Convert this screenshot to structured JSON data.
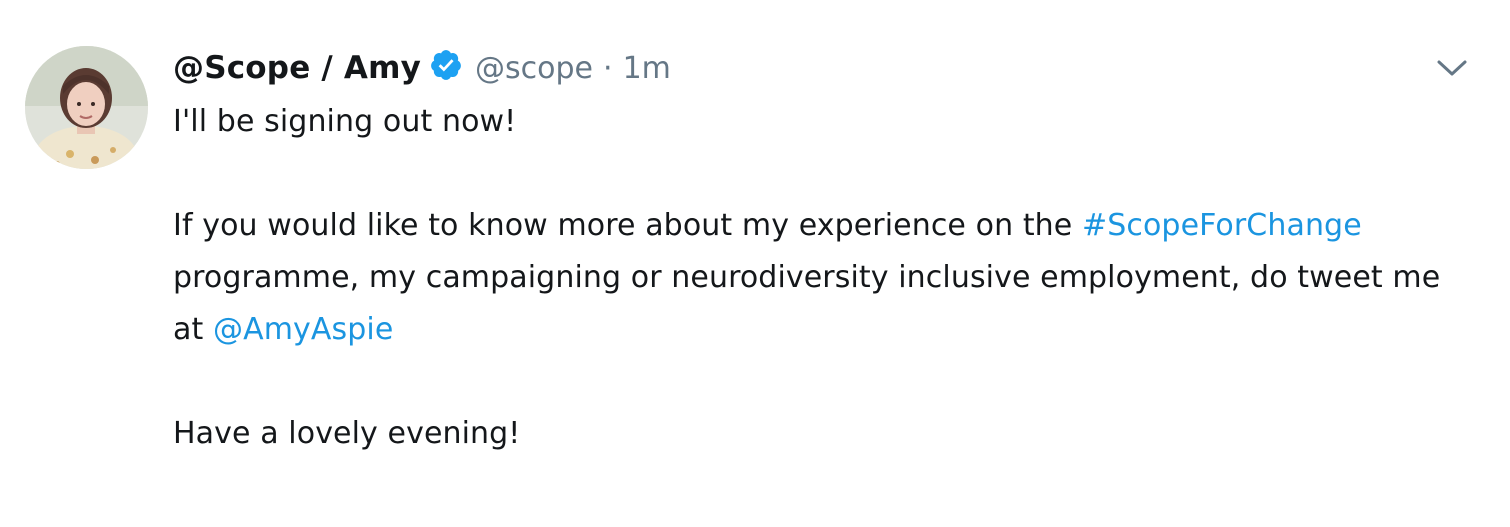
{
  "tweet": {
    "display_name": "@Scope / Amy",
    "handle": "@scope",
    "separator": "·",
    "time": "1m",
    "verified": true,
    "paragraphs": {
      "p1": "I'll be signing out now!",
      "p2_part1": "If you would like to know more about my experience on the ",
      "p2_hashtag": "#ScopeForChange",
      "p2_part2": " programme, my campaigning or neurodiversity inclusive employment, do tweet me at ",
      "p2_mention": "@AmyAspie",
      "p3": "Have a lovely evening!"
    }
  },
  "icons": {
    "avatar": "profile-photo",
    "verified": "verified-badge-icon",
    "caret": "chevron-down-icon"
  },
  "colors": {
    "link": "#1b95e0",
    "verified": "#1da1f2",
    "secondary_text": "#657786",
    "primary_text": "#14171a"
  }
}
